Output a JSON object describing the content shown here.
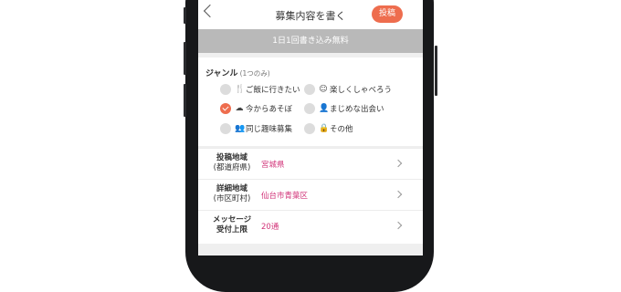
{
  "header": {
    "title": "募集内容を書く",
    "post_label": "投稿"
  },
  "banner": {
    "text": "1日1回書き込み無料"
  },
  "genre": {
    "title": "ジャンル",
    "subtitle": "(1つのみ)",
    "options": [
      {
        "label": "ご飯に行きたい",
        "icon": "fork-knife-icon",
        "selected": false
      },
      {
        "label": "楽しくしゃべろう",
        "icon": "smile-chat-icon",
        "selected": false
      },
      {
        "label": "今からあそぼ",
        "icon": "cloud-icon",
        "selected": true
      },
      {
        "label": "まじめな出会い",
        "icon": "person-icon",
        "selected": false
      },
      {
        "label": "同じ趣味募集",
        "icon": "group-icon",
        "selected": false
      },
      {
        "label": "その他",
        "icon": "lock-icon",
        "selected": false
      }
    ]
  },
  "fields": [
    {
      "label_line1": "投稿地域",
      "label_line2": "(都道府県)",
      "value": "宮城県"
    },
    {
      "label_line1": "詳細地域",
      "label_line2": "(市区町村)",
      "value": "仙台市青葉区"
    },
    {
      "label_line1": "メッセージ",
      "label_line2": "受付上限",
      "value": "20通"
    }
  ],
  "colors": {
    "accent": "#ee6d4e",
    "value_text": "#d2357a",
    "banner_bg": "#b9b9b9"
  }
}
